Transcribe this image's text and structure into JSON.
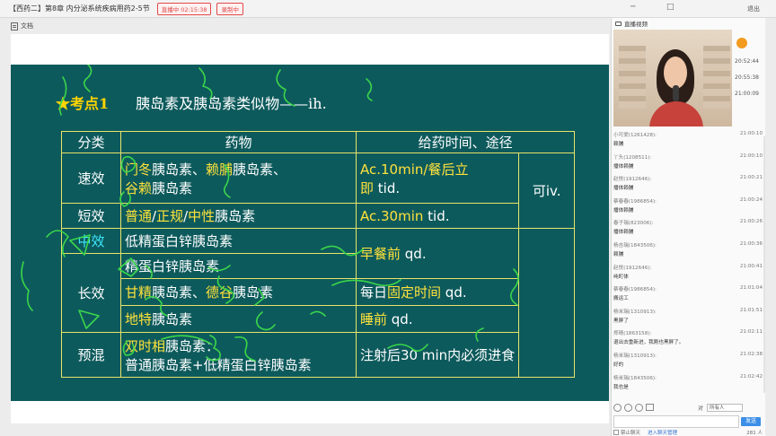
{
  "window": {
    "title": "【西药二】第8章  内分泌系统疾病用药2-5节",
    "live_badge": "直播中 02:15:38",
    "rec_badge": "录制中",
    "logout": "退出"
  },
  "docbar": {
    "label": "文档"
  },
  "slide": {
    "star": "★",
    "kaodian": "考点1",
    "title": "胰岛素及胰岛素类似物——ih.",
    "headers": [
      "分类",
      "药物",
      "给药时间、途径"
    ],
    "rows": {
      "sux": {
        "cat": "速效",
        "drug1_hl": "门冬",
        "drug1_rest": "胰岛素、",
        "drug2_hl": "赖脯",
        "drug2_rest": "胰岛素、",
        "drug3_hl": "谷赖",
        "drug3_rest": "胰岛素",
        "time_line1": "Ac.10min/餐后立",
        "time_line2a": "即",
        "time_line2b": " tid."
      },
      "route_shared": "可iv.",
      "duan": {
        "cat": "短效",
        "drug_a": "普通",
        "sep1": "/",
        "drug_b": "正规",
        "sep2": "/",
        "drug_c": "中性",
        "drug_rest": "胰岛素",
        "time_hl": "Ac.30min",
        "time_rest": " tid."
      },
      "zhong": {
        "cat": "中效",
        "drug": "低精蛋白锌胰岛素"
      },
      "chang": {
        "cat": "长效",
        "drug1": "精蛋白锌胰岛素",
        "time1_hl": "早餐前",
        "time1_rest": " qd.",
        "drug2_a": "甘精",
        "drug2_a_rest": "胰岛素、",
        "drug2_b": "德谷",
        "drug2_b_rest": "胰岛素",
        "time2_pre": "每日",
        "time2_hl": "固定时间",
        "time2_rest": " qd.",
        "drug3_hl": "地特",
        "drug3_rest": "胰岛素",
        "time3_hl": "睡前",
        "time3_rest": " qd."
      },
      "yuhun": {
        "cat": "预混",
        "drug_hl": "双时相",
        "drug_rest": "胰岛素：",
        "drug_line2": "普通胰岛素+低精蛋白锌胰岛素",
        "time": "注射后30 min内必须进食"
      }
    }
  },
  "right_panel": {
    "header": "直播视频",
    "times": [
      "20:52:44",
      "20:55:38",
      "21:00:09"
    ],
    "messages": [
      {
        "who": "小可爱(1261428):",
        "time": "21:00:10",
        "text": "赖脯"
      },
      {
        "who": "丫头(1208511):",
        "time": "21:00:10",
        "text": "播体赖脯"
      },
      {
        "who": "赵悦(1912646):",
        "time": "21:00:21",
        "text": "播体赖脯"
      },
      {
        "who": "蔡春春(1986854):",
        "time": "21:00:24",
        "text": "播体赖脯"
      },
      {
        "who": "春子瑞(823006):",
        "time": "21:00:26",
        "text": "播体赖脯"
      },
      {
        "who": "杨吉瑞(1843506):",
        "time": "21:00:36",
        "text": "赖脯"
      },
      {
        "who": "赵悦(1912646):",
        "time": "21:00:41",
        "text": "纯町体"
      },
      {
        "who": "蔡春春(1986854):",
        "time": "21:01:04",
        "text": "搬运工"
      },
      {
        "who": "杨米瑞(1310913):",
        "time": "21:01:51",
        "text": "黑屏了"
      },
      {
        "who": "郑晴(1863158):",
        "time": "21:02:11",
        "text": "退出去重新进，我刚也黑屏了。"
      },
      {
        "who": "杨米瑞(1310913):",
        "time": "21:02:38",
        "text": "好的"
      },
      {
        "who": "杨米瑞(1843506):",
        "time": "21:02:42",
        "text": "我也是"
      }
    ],
    "to_label": "对",
    "to_value": "所有人",
    "send": "发送",
    "mute_label": "禁止聊天",
    "manage_link": "进入聊天管理",
    "online_count": "281 人"
  }
}
